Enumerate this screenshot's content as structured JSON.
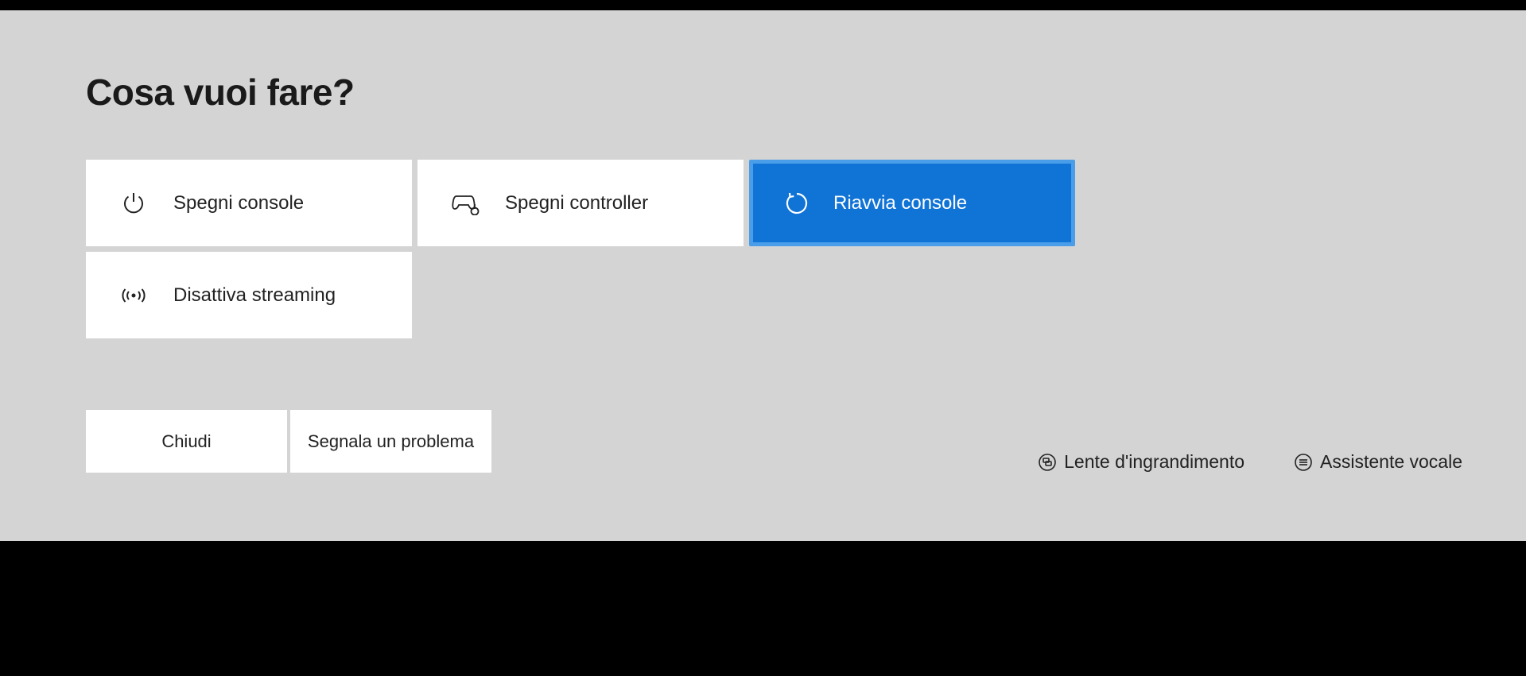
{
  "title": "Cosa vuoi fare?",
  "tiles": {
    "power_off_console": "Spegni console",
    "power_off_controller": "Spegni controller",
    "restart_console": "Riavvia console",
    "disable_streaming": "Disattiva streaming"
  },
  "actions": {
    "close": "Chiudi",
    "report_problem": "Segnala un problema"
  },
  "shortcuts": {
    "magnifier": "Lente d'ingrandimento",
    "narrator": "Assistente vocale"
  }
}
